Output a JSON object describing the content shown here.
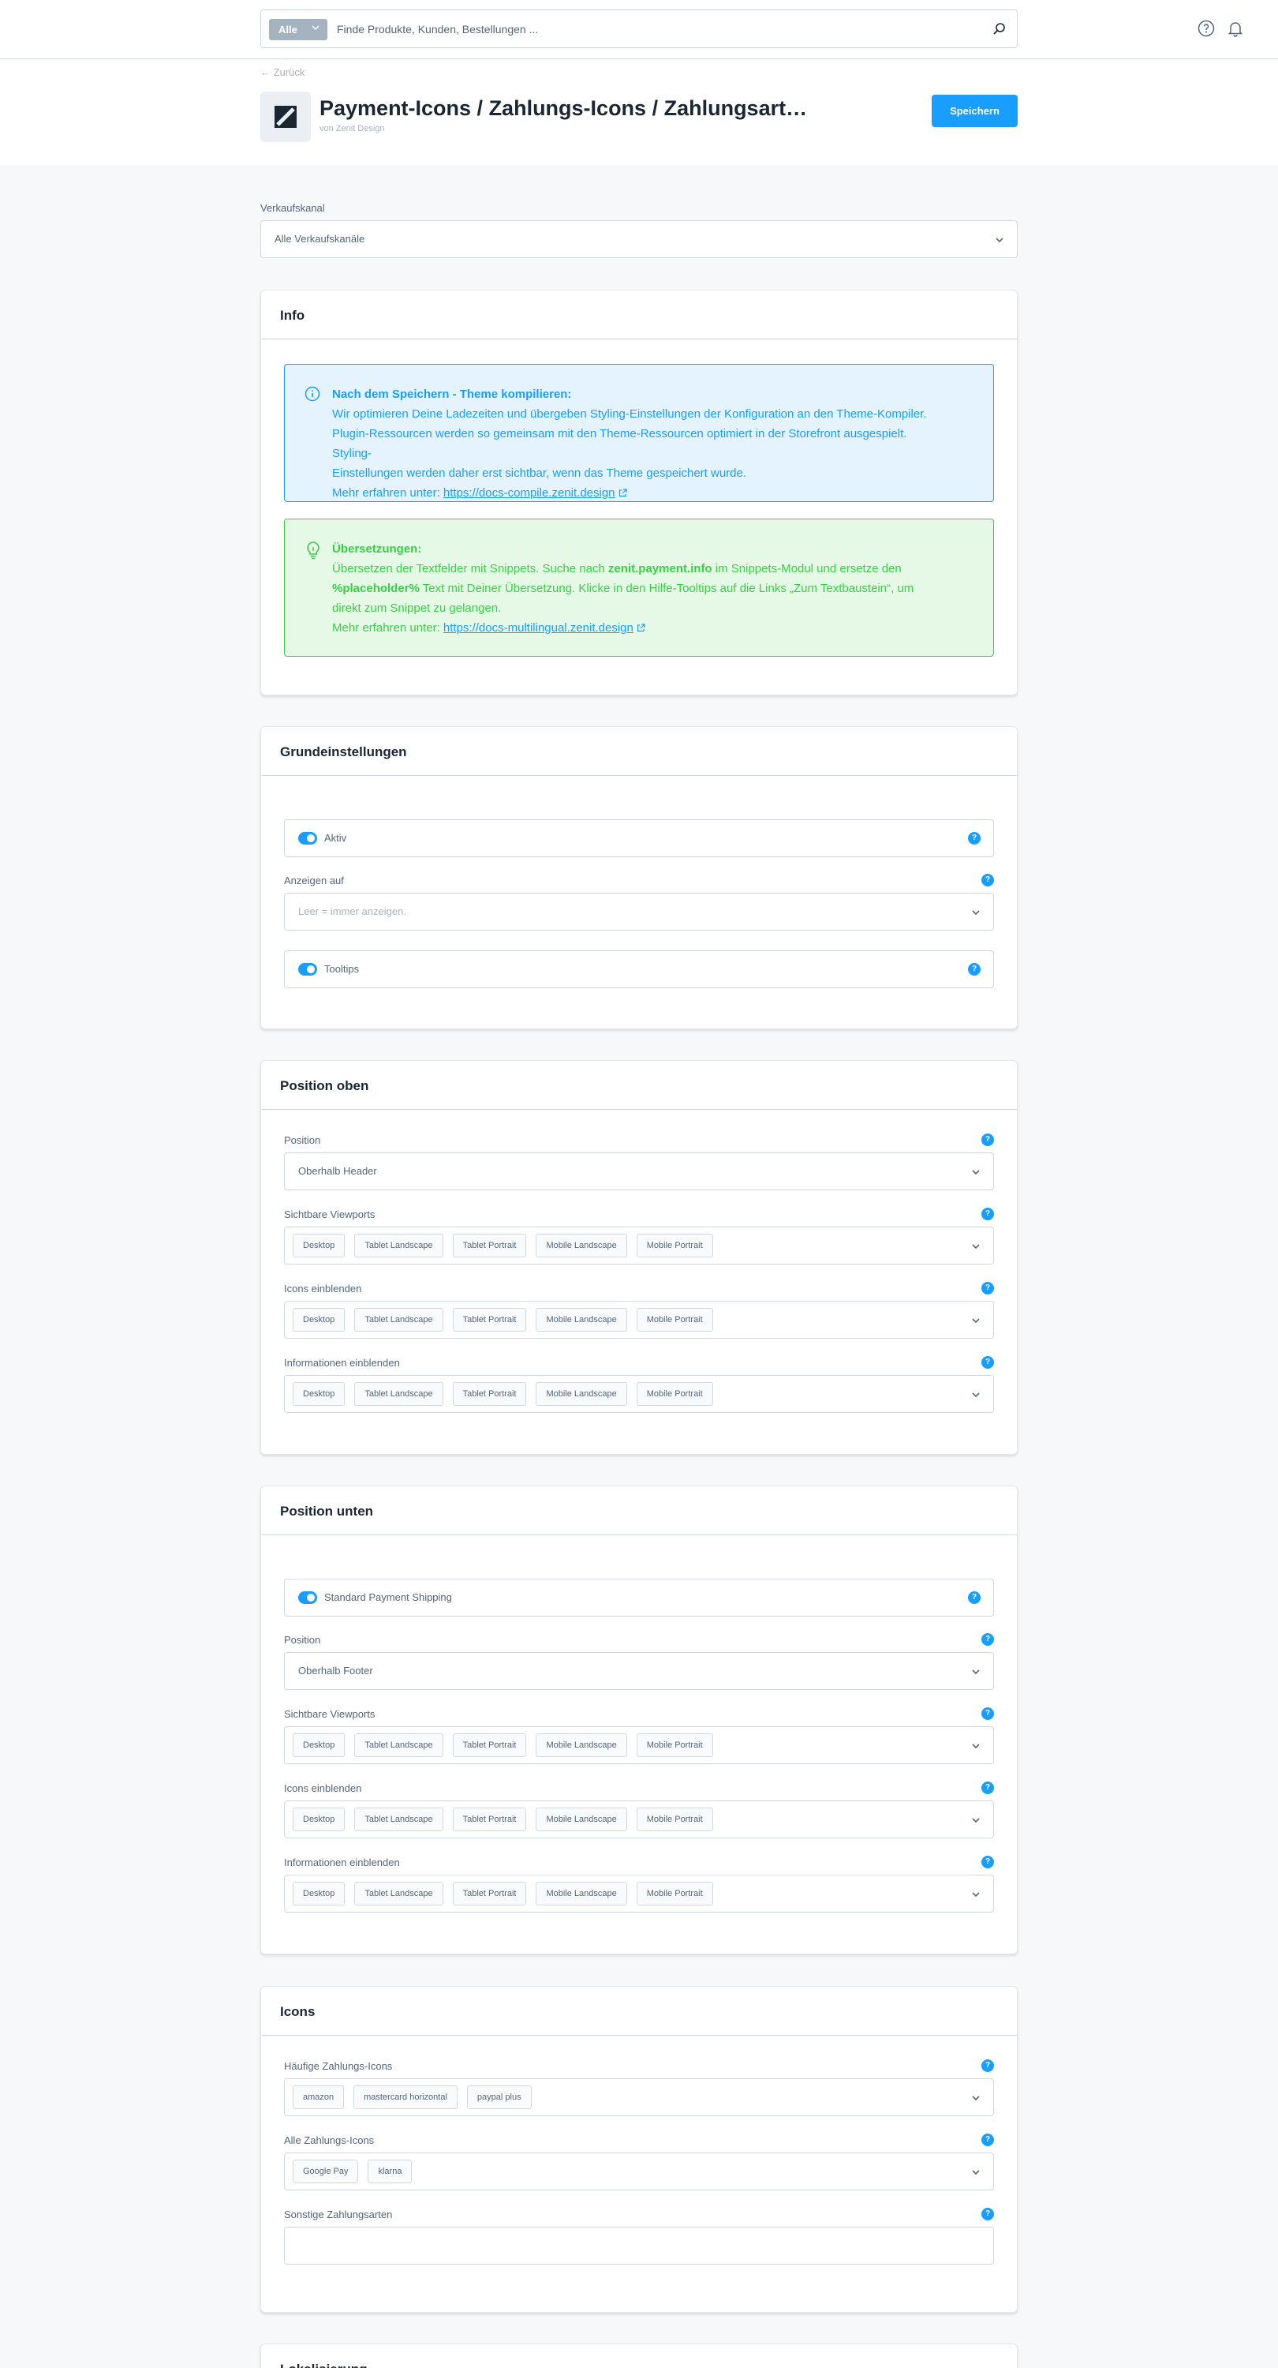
{
  "topbar": {
    "search_type": "Alle",
    "search_placeholder": "Finde Produkte, Kunden, Bestellungen ..."
  },
  "header": {
    "back_label": "Zurück",
    "title": "Payment-Icons / Zahlungs-Icons / Zahlungsart…",
    "subtitle": "von Zenit Design",
    "save_label": "Speichern"
  },
  "saleschannel": {
    "label": "Verkaufskanal",
    "value": "Alle Verkaufskanäle"
  },
  "info": {
    "title": "Info",
    "compile_heading": "Nach dem Speichern - Theme kompilieren:",
    "compile_lines": [
      "Wir optimieren Deine Ladezeiten und übergeben Styling-Einstellungen der Konfiguration an den Theme-Kompiler.",
      "Plugin-Ressourcen werden so gemeinsam mit den Theme-Ressourcen optimiert in der Storefront ausgespielt. Styling-",
      "Einstellungen werden daher erst sichtbar, wenn das Theme gespeichert wurde."
    ],
    "compile_more_prefix": "Mehr erfahren unter: ",
    "compile_link": "https://docs-compile.zenit.design",
    "translation_heading": "Übersetzungen:",
    "translation_line1_a": "Übersetzen der Textfelder mit Snippets. Suche nach ",
    "translation_line1_b": "zenit.payment.info",
    "translation_line1_c": " im Snippets-Modul und ersetze den",
    "translation_line2_a": "%placeholder%",
    "translation_line2_b": " Text mit Deiner Übersetzung. Klicke in den Hilfe-Tooltips auf die Links „Zum Textbaustein“, um",
    "translation_line3": "direkt zum Snippet zu gelangen.",
    "translation_more_prefix": "Mehr erfahren unter: ",
    "translation_link": "https://docs-multilingual.zenit.design"
  },
  "basic": {
    "title": "Grundeinstellungen",
    "active_label": "Aktiv",
    "show_on_label": "Anzeigen auf",
    "show_on_placeholder": "Leer = immer anzeigen.",
    "tooltips_label": "Tooltips"
  },
  "top": {
    "title": "Position oben",
    "position_label": "Position",
    "position_value": "Oberhalb Header",
    "viewports_label": "Sichtbare Viewports",
    "icons_label": "Icons einblenden",
    "info_label": "Informationen einblenden",
    "tags": [
      "Desktop",
      "Tablet Landscape",
      "Tablet Portrait",
      "Mobile Landscape",
      "Mobile Portrait"
    ]
  },
  "bottom": {
    "title": "Position unten",
    "standard_label": "Standard Payment Shipping",
    "position_label": "Position",
    "position_value": "Oberhalb Footer",
    "viewports_label": "Sichtbare Viewports",
    "icons_label": "Icons einblenden",
    "info_label": "Informationen einblenden",
    "tags": [
      "Desktop",
      "Tablet Landscape",
      "Tablet Portrait",
      "Mobile Landscape",
      "Mobile Portrait"
    ]
  },
  "icons": {
    "title": "Icons",
    "frequent_label": "Häufige Zahlungs-Icons",
    "frequent_tags": [
      "amazon",
      "mastercard horizontal",
      "paypal plus"
    ],
    "all_label": "Alle Zahlungs-Icons",
    "all_tags": [
      "Google Pay",
      "klarna"
    ],
    "other_label": "Sonstige Zahlungsarten"
  },
  "next_card": {
    "title": "Lokalisierung"
  },
  "help_glyph": "?",
  "colors": {
    "primary": "#189eff",
    "success": "#37d046",
    "text": "#52667a",
    "heading": "#1a2633",
    "border": "#d1d9e0"
  }
}
